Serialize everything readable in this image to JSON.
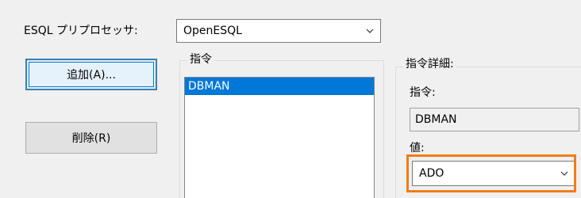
{
  "preprocessor": {
    "label": "ESQL プリプロセッサ:",
    "selected": "OpenESQL"
  },
  "buttons": {
    "add": "追加(A)...",
    "remove": "削除(R)"
  },
  "directives": {
    "group_title": "指令",
    "items": [
      "DBMAN"
    ],
    "selected_index": 0
  },
  "details": {
    "group_title": "指令詳細:",
    "directive_label": "指令:",
    "directive_value": "DBMAN",
    "value_label": "値:",
    "value_selected": "ADO"
  },
  "colors": {
    "selection": "#0078d7",
    "highlight": "#f07c1b"
  },
  "icons": {
    "dropdown": "chevron-down-icon"
  }
}
